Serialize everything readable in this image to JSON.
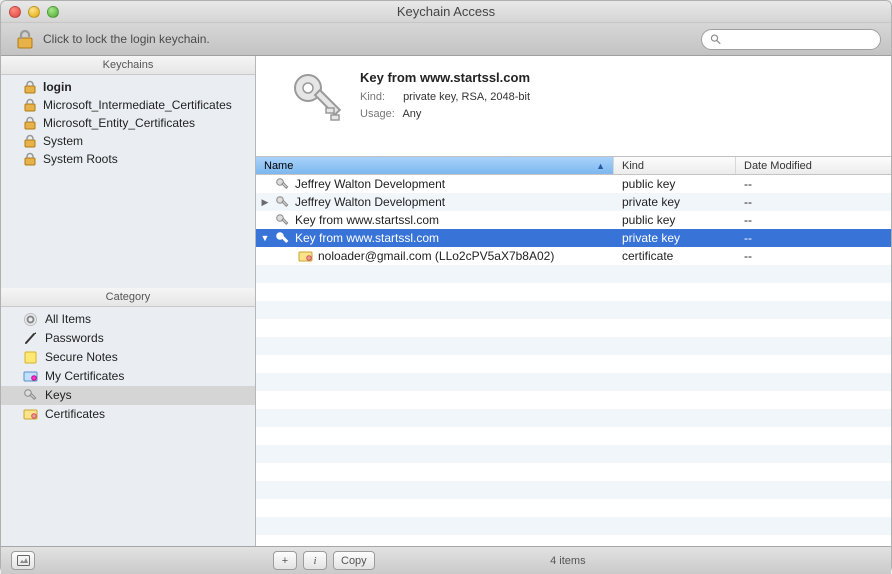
{
  "window": {
    "title": "Keychain Access"
  },
  "toolbar": {
    "lock_text": "Click to lock the login keychain.",
    "search_placeholder": ""
  },
  "sidebar": {
    "keychains_label": "Keychains",
    "category_label": "Category",
    "keychains": [
      {
        "label": "login",
        "bold": true
      },
      {
        "label": "Microsoft_Intermediate_Certificates",
        "bold": false
      },
      {
        "label": "Microsoft_Entity_Certificates",
        "bold": false
      },
      {
        "label": "System",
        "bold": false
      },
      {
        "label": "System Roots",
        "bold": false
      }
    ],
    "categories": [
      {
        "label": "All Items",
        "icon": "all"
      },
      {
        "label": "Passwords",
        "icon": "pen"
      },
      {
        "label": "Secure Notes",
        "icon": "note"
      },
      {
        "label": "My Certificates",
        "icon": "mycert"
      },
      {
        "label": "Keys",
        "icon": "key",
        "selected": true
      },
      {
        "label": "Certificates",
        "icon": "cert"
      }
    ]
  },
  "detail": {
    "title": "Key from www.startssl.com",
    "kind_label": "Kind:",
    "kind_value": "private key, RSA, 2048-bit",
    "usage_label": "Usage:",
    "usage_value": "Any"
  },
  "columns": {
    "name": "Name",
    "kind": "Kind",
    "date": "Date Modified"
  },
  "rows": [
    {
      "indent": 0,
      "disclosure": "",
      "icon": "key",
      "name": "Jeffrey Walton Development",
      "kind": "public key",
      "date": "--",
      "selected": false
    },
    {
      "indent": 0,
      "disclosure": "right",
      "icon": "key",
      "name": "Jeffrey Walton Development",
      "kind": "private key",
      "date": "--",
      "selected": false
    },
    {
      "indent": 0,
      "disclosure": "",
      "icon": "key",
      "name": "Key from www.startssl.com",
      "kind": "public key",
      "date": "--",
      "selected": false
    },
    {
      "indent": 0,
      "disclosure": "down",
      "icon": "key",
      "name": "Key from www.startssl.com",
      "kind": "private key",
      "date": "--",
      "selected": true
    },
    {
      "indent": 1,
      "disclosure": "",
      "icon": "cert",
      "name": "noloader@gmail.com (LLo2cPV5aX7b8A02)",
      "kind": "certificate",
      "date": "--",
      "selected": false
    }
  ],
  "bottom": {
    "add": "+",
    "info": "i",
    "copy": "Copy",
    "status": "4 items"
  }
}
